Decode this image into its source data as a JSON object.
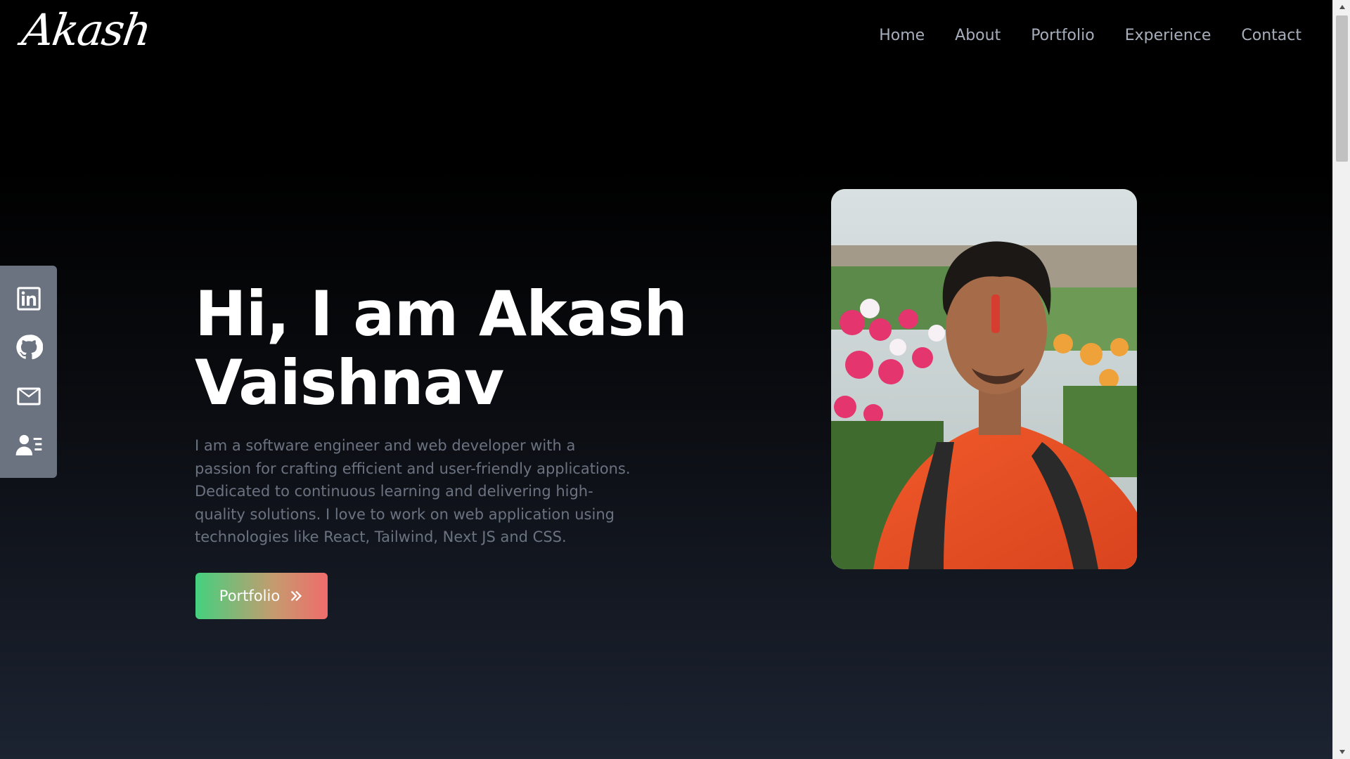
{
  "header": {
    "logo": "Akash",
    "nav": [
      "Home",
      "About",
      "Portfolio",
      "Experience",
      "Contact"
    ]
  },
  "social": {
    "icons": [
      "linkedin-icon",
      "github-icon",
      "mail-icon",
      "resume-icon"
    ]
  },
  "hero": {
    "title_line1": "Hi, I am Akash",
    "title_line2": "Vaishnav",
    "description": "I am a software engineer and web developer with a passion for crafting efficient and user-friendly applications. Dedicated to continuous learning and delivering high-quality solutions. I love to work on web application using technologies like React, Tailwind, Next JS and CSS.",
    "button_label": "Portfolio",
    "button_icon": "double-chevron-right-icon"
  },
  "colors": {
    "background": "#000000",
    "nav_text": "#a7aebb",
    "description_text": "#6b7280",
    "social_bar": "#6b7280",
    "button_gradient_start": "#44d17f",
    "button_gradient_end": "#ef6c6c"
  }
}
